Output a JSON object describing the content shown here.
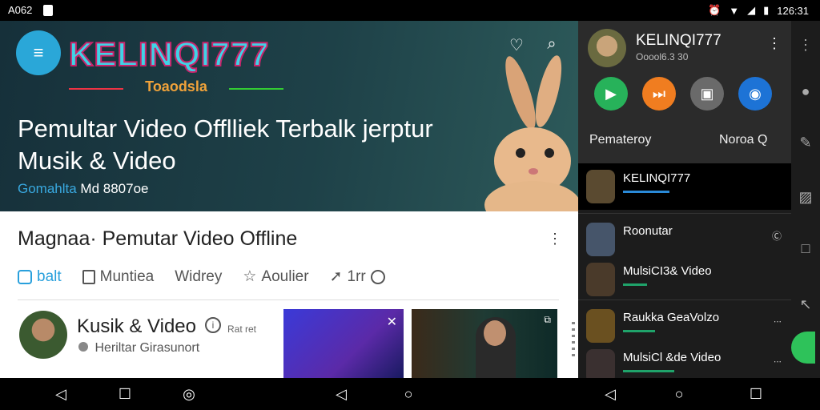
{
  "status": {
    "left_text": "A062",
    "time": "126:31"
  },
  "hero": {
    "logo_text": "KELINQI777",
    "tagline": "Toaodsla",
    "headline": "Pemultar Video Offlliek Terbalk jerptur Musik & Video",
    "sub_blue": "Gomahlta",
    "sub_white": " Md 8807oe"
  },
  "content": {
    "title": "Magnaa· Pemutar Video Offline",
    "tabs": [
      {
        "label": "balt",
        "icon": "badge-icon"
      },
      {
        "label": "Muntiea",
        "icon": "bookmark-icon"
      },
      {
        "label": "Widrey",
        "icon": ""
      },
      {
        "label": "Aoulier",
        "icon": "star-icon"
      },
      {
        "label": "1rr",
        "icon": "share-icon"
      }
    ],
    "channel": {
      "name": "Kusik & Video",
      "meta": "Rat ret",
      "subtitle": "Heriltar Girasunort"
    }
  },
  "panel": {
    "name": "KELINQI777",
    "sub": "Ooool6.3 30",
    "buttons": [
      {
        "icon": "play-icon",
        "color": "#27b25a"
      },
      {
        "icon": "next-icon",
        "color": "#f07d20"
      },
      {
        "icon": "save-icon",
        "color": "#6a6a6a"
      },
      {
        "icon": "target-icon",
        "color": "#1d73d6"
      }
    ],
    "label_left": "Pemateroy",
    "label_right": "Noroa Q",
    "items": [
      {
        "title": "KELINQI777",
        "right": ""
      },
      {
        "title": "Roonutar",
        "right": "Ⓒ"
      },
      {
        "title": "MulsiCI3& Video",
        "right": ""
      },
      {
        "title": "Raukka GeaVolzo",
        "right": "∙∙∙"
      },
      {
        "title": "MulsiCl &de Video",
        "right": "∙∙∙"
      }
    ]
  }
}
